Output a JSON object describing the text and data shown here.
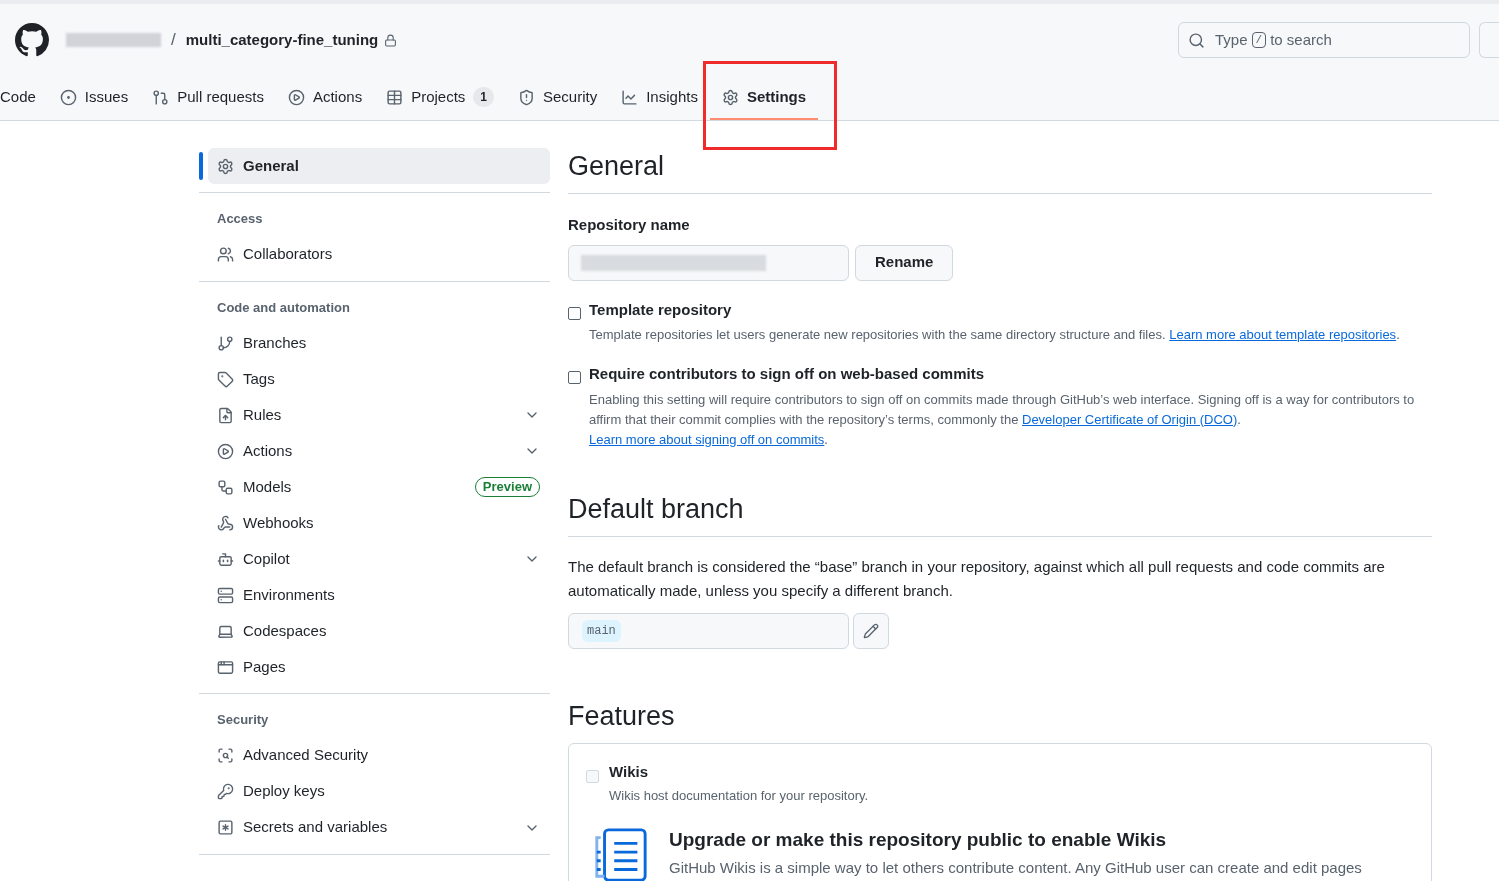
{
  "header": {
    "separator": "/",
    "repo_name": "multi_category-fine_tuning",
    "private": true,
    "search": {
      "before": "Type",
      "key": "/",
      "after": "to search"
    }
  },
  "tabs": [
    {
      "label": "Code",
      "selected": false
    },
    {
      "label": "Issues",
      "selected": false
    },
    {
      "label": "Pull requests",
      "selected": false
    },
    {
      "label": "Actions",
      "selected": false
    },
    {
      "label": "Projects",
      "counter": "1",
      "selected": false
    },
    {
      "label": "Security",
      "selected": false
    },
    {
      "label": "Insights",
      "selected": false
    },
    {
      "label": "Settings",
      "selected": true
    }
  ],
  "sidebar": [
    {
      "items": [
        {
          "label": "General",
          "selected": true,
          "expandable": false
        }
      ]
    },
    {
      "heading": "Access",
      "items": [
        {
          "label": "Collaborators",
          "selected": false,
          "expandable": false
        }
      ]
    },
    {
      "heading": "Code and automation",
      "items": [
        {
          "label": "Branches",
          "selected": false,
          "expandable": false
        },
        {
          "label": "Tags",
          "selected": false,
          "expandable": false
        },
        {
          "label": "Rules",
          "selected": false,
          "expandable": true
        },
        {
          "label": "Actions",
          "selected": false,
          "expandable": true
        },
        {
          "label": "Models",
          "badge": "Preview",
          "selected": false,
          "expandable": false
        },
        {
          "label": "Webhooks",
          "selected": false,
          "expandable": false
        },
        {
          "label": "Copilot",
          "selected": false,
          "expandable": true
        },
        {
          "label": "Environments",
          "selected": false,
          "expandable": false
        },
        {
          "label": "Codespaces",
          "selected": false,
          "expandable": false
        },
        {
          "label": "Pages",
          "selected": false,
          "expandable": false
        }
      ]
    },
    {
      "heading": "Security",
      "items": [
        {
          "label": "Advanced Security",
          "selected": false,
          "expandable": false
        },
        {
          "label": "Deploy keys",
          "selected": false,
          "expandable": false
        },
        {
          "label": "Secrets and variables",
          "selected": false,
          "expandable": true
        }
      ]
    }
  ],
  "general": {
    "title": "General",
    "repo_label": "Repository name",
    "rename_button": "Rename",
    "options": [
      {
        "label": "Template repository",
        "checked": false,
        "description": [
          {
            "text": "Template repositories let users generate new repositories with the same directory structure and files. "
          },
          {
            "link": "Learn more about template repositories"
          },
          {
            "text": "."
          }
        ]
      },
      {
        "label": "Require contributors to sign off on web-based commits",
        "checked": false,
        "description": [
          {
            "text": "Enabling this setting will require contributors to sign off on commits made through GitHub’s web interface. Signing off is a way for contributors to affirm that their commit complies with the repository’s terms, commonly the "
          },
          {
            "link": "Developer Certificate of Origin (DCO)"
          },
          {
            "text": ". "
          },
          {
            "link": "Learn more about signing off on commits"
          },
          {
            "text": "."
          }
        ]
      }
    ]
  },
  "default_branch": {
    "title": "Default branch",
    "description": "The default branch is considered the “base” branch in your repository, against which all pull requests and code commits are automatically made, unless you specify a different branch.",
    "branch": "main"
  },
  "features": {
    "title": "Features",
    "wikis": {
      "label": "Wikis",
      "checked": false,
      "disabled": true,
      "description": "Wikis host documentation for your repository.",
      "upgrade_title": "Upgrade or make this repository public to enable Wikis",
      "upgrade_text": "GitHub Wikis is a simple way to let others contribute content. Any GitHub user can create and edit pages"
    }
  }
}
